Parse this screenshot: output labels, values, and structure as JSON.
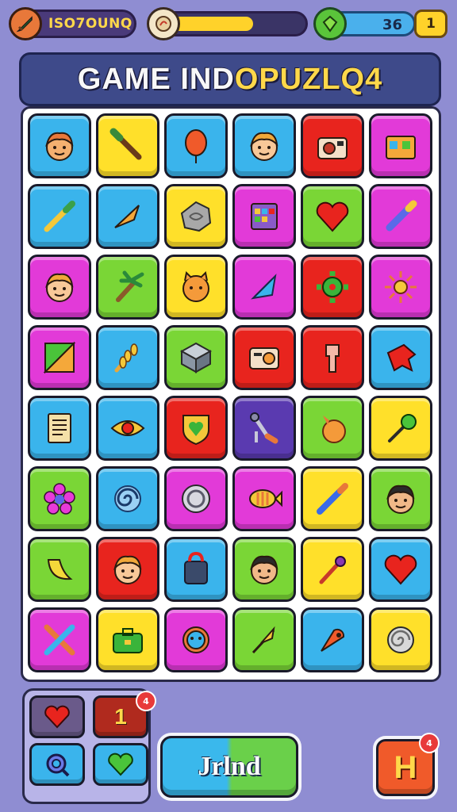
{
  "hud": {
    "player_label": "ISO7OUNQ",
    "progress_fraction": 0.52,
    "gem_count": "36",
    "level": "1"
  },
  "title": {
    "part1": "GAME IND",
    "part2": "OPUZLQ4"
  },
  "colors": {
    "background": "#8f8dd2",
    "tile_blue": "#3ab4ec",
    "tile_yellow": "#ffe02a",
    "tile_red": "#e8241e",
    "tile_magenta": "#e23ad8",
    "tile_green": "#7ad636",
    "tile_purple": "#5a3ab0"
  },
  "board": {
    "rows": [
      [
        {
          "c": "blue",
          "i": "fox-face-icon"
        },
        {
          "c": "yellow",
          "i": "paintbrush-icon"
        },
        {
          "c": "blue",
          "i": "balloon-icon"
        },
        {
          "c": "blue",
          "i": "boy-face-icon"
        },
        {
          "c": "red",
          "i": "camera-icon"
        },
        {
          "c": "magenta",
          "i": "toolbox-icon"
        }
      ],
      [
        {
          "c": "blue",
          "i": "pencil-icon"
        },
        {
          "c": "blue",
          "i": "arrow-icon"
        },
        {
          "c": "yellow",
          "i": "stone-disc-icon"
        },
        {
          "c": "magenta",
          "i": "calendar-icon"
        },
        {
          "c": "green",
          "i": "heart-icon"
        },
        {
          "c": "magenta",
          "i": "marker-icon"
        }
      ],
      [
        {
          "c": "magenta",
          "i": "boy-face-icon"
        },
        {
          "c": "green",
          "i": "palm-broom-icon"
        },
        {
          "c": "yellow",
          "i": "cat-face-icon"
        },
        {
          "c": "magenta",
          "i": "leaf-pen-icon"
        },
        {
          "c": "red",
          "i": "gear-icon"
        },
        {
          "c": "magenta",
          "i": "sun-icon"
        }
      ],
      [
        {
          "c": "magenta",
          "i": "palette-icon"
        },
        {
          "c": "blue",
          "i": "wheat-icon"
        },
        {
          "c": "green",
          "i": "cube-icon"
        },
        {
          "c": "red",
          "i": "radio-icon"
        },
        {
          "c": "red",
          "i": "key-icon"
        },
        {
          "c": "blue",
          "i": "dog-icon"
        }
      ],
      [
        {
          "c": "blue",
          "i": "document-icon"
        },
        {
          "c": "blue",
          "i": "eye-icon"
        },
        {
          "c": "red",
          "i": "shield-icon"
        },
        {
          "c": "purple",
          "i": "tools-icon"
        },
        {
          "c": "green",
          "i": "orange-icon"
        },
        {
          "c": "yellow",
          "i": "brush-icon"
        }
      ],
      [
        {
          "c": "green",
          "i": "flower-icon"
        },
        {
          "c": "blue",
          "i": "spiral-icon"
        },
        {
          "c": "magenta",
          "i": "coin-icon"
        },
        {
          "c": "magenta",
          "i": "fish-icon"
        },
        {
          "c": "yellow",
          "i": "pen-icon"
        },
        {
          "c": "green",
          "i": "man-face-icon"
        }
      ],
      [
        {
          "c": "green",
          "i": "banana-icon"
        },
        {
          "c": "red",
          "i": "boy-face-icon"
        },
        {
          "c": "blue",
          "i": "bag-icon"
        },
        {
          "c": "green",
          "i": "man-face-icon"
        },
        {
          "c": "yellow",
          "i": "wand-icon"
        },
        {
          "c": "blue",
          "i": "heart-icon"
        }
      ],
      [
        {
          "c": "magenta",
          "i": "crossed-tools-icon"
        },
        {
          "c": "yellow",
          "i": "briefcase-icon"
        },
        {
          "c": "magenta",
          "i": "donut-icon"
        },
        {
          "c": "green",
          "i": "quill-icon"
        },
        {
          "c": "blue",
          "i": "pin-icon"
        },
        {
          "c": "yellow",
          "i": "shell-icon"
        }
      ]
    ]
  },
  "powerups": {
    "hint_number": "1",
    "hint_notif": "4"
  },
  "play_button_label": "Jrlnd",
  "corner_button": {
    "label": "H",
    "notif": "4"
  }
}
